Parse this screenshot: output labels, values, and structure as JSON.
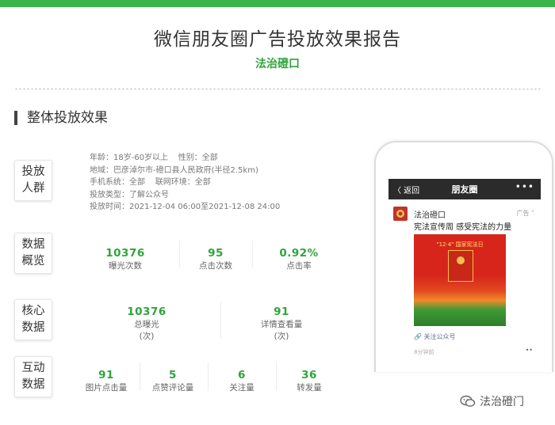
{
  "header": {
    "title": "微信朋友圈广告投放效果报告",
    "subtitle": "法治磴口"
  },
  "section": {
    "title": "整体投放效果"
  },
  "audience": {
    "label": "投放\n人群",
    "lines": [
      "年龄：18岁-60岁以上    性别：全部",
      "地域：巴彦淖尔市-磴口县人民政府(半径2.5km)",
      "手机系统：全部    联网环境：全部",
      "投放类型：了解公众号",
      "投放时间：2021-12-04 06:00至2021-12-08 24:00"
    ]
  },
  "overview": {
    "label": "数据\n概览",
    "stats": [
      {
        "value": "10376",
        "label": "曝光次数"
      },
      {
        "value": "95",
        "label": "点击次数"
      },
      {
        "value": "0.92%",
        "label": "点击率"
      }
    ]
  },
  "core": {
    "label": "核心\n数据",
    "stats": [
      {
        "value": "10376",
        "label": "总曝光",
        "unit": "(次)"
      },
      {
        "value": "91",
        "label": "详情查看量",
        "unit": "(次)"
      }
    ]
  },
  "interaction": {
    "label": "互动\n数据",
    "stats": [
      {
        "value": "91",
        "label": "图片点击量"
      },
      {
        "value": "5",
        "label": "点赞评论量"
      },
      {
        "value": "6",
        "label": "关注量"
      },
      {
        "value": "36",
        "label": "转发量"
      }
    ]
  },
  "phone": {
    "back": "〈 返回",
    "title": "朋友圈",
    "more": "•••",
    "account": "法治磴口",
    "ad_tag": "广告 ˅",
    "post_text": "宪法宣传周  感受宪法的力量",
    "poster_caption": "\"12·4\" 国家宪法日",
    "follow": "关注公众号",
    "time": "8分钟前",
    "dots": "••"
  },
  "watermark": {
    "text": "法治磴门"
  },
  "colors": {
    "accent": "#3bb54a",
    "value_green": "#2fa43c",
    "wechat_dark": "#2b2b2b"
  }
}
